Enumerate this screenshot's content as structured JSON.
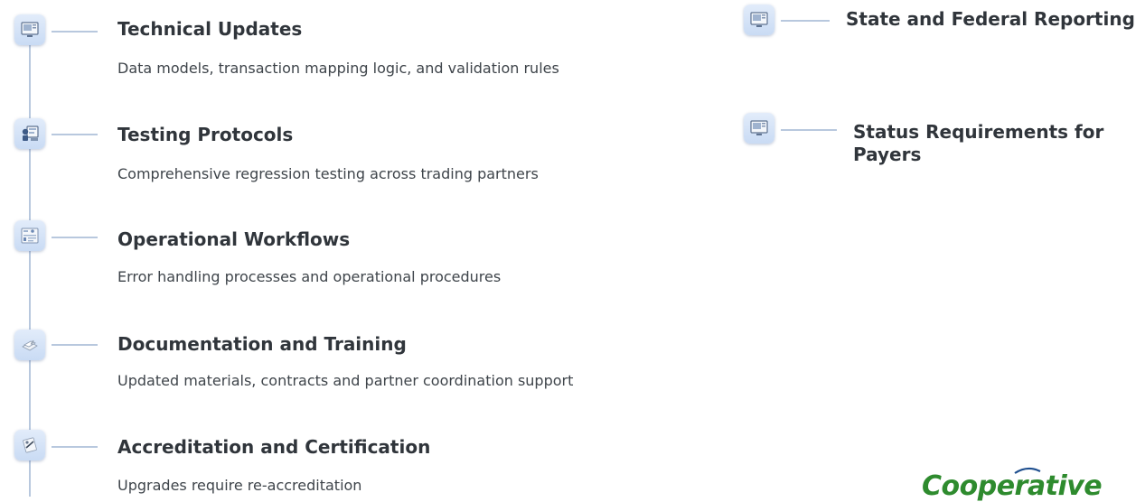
{
  "left_items": [
    {
      "icon": "monitor-icon",
      "title": "Technical Updates",
      "description": "Data models, transaction mapping logic, and validation rules"
    },
    {
      "icon": "testing-icon",
      "title": "Testing Protocols",
      "description": "Comprehensive regression testing across trading partners"
    },
    {
      "icon": "workflow-icon",
      "title": "Operational Workflows",
      "description": "Error handling processes and operational procedures"
    },
    {
      "icon": "documents-icon",
      "title": "Documentation and Training",
      "description": "Updated materials, contracts and partner coordination support"
    },
    {
      "icon": "certificate-icon",
      "title": "Accreditation and Certification",
      "description": "Upgrades require re-accreditation"
    }
  ],
  "right_items": [
    {
      "icon": "monitor-icon",
      "title": "State and Federal Reporting"
    },
    {
      "icon": "monitor-icon",
      "title": "Status Requirements for Payers"
    }
  ],
  "logo": {
    "text": "Cooperative",
    "color": "#2e8b2e"
  },
  "colors": {
    "line": "#b8c8de",
    "icon_bg": "#d4e3f7",
    "title": "#30353b",
    "text": "#3e444a"
  }
}
